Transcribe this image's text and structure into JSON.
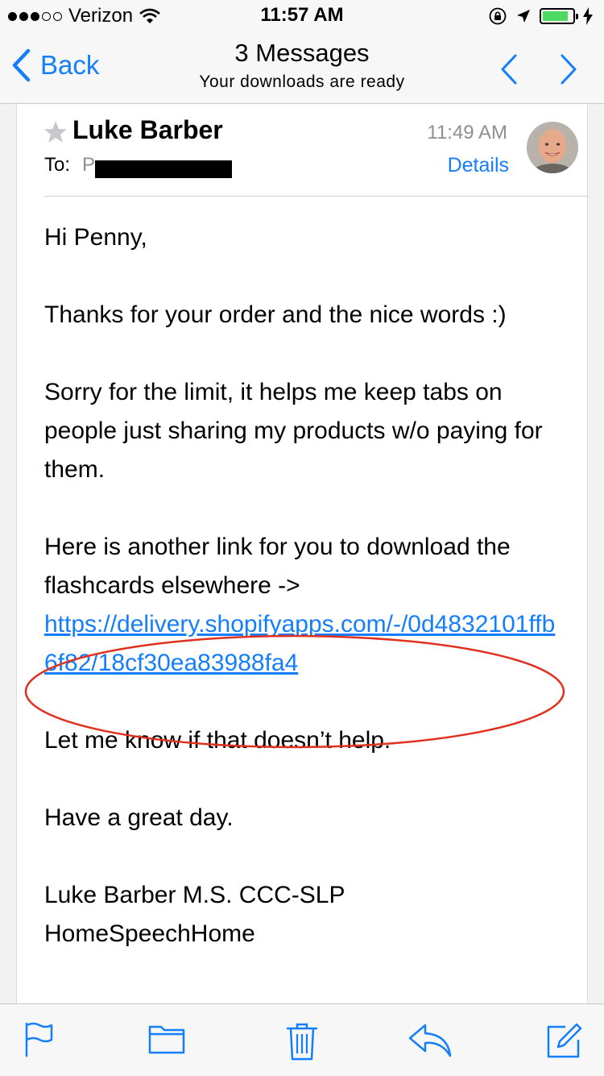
{
  "status_bar": {
    "carrier": "Verizon",
    "time": "11:57 AM",
    "battery_level": 0.85,
    "colors": {
      "battery": "#4cd964"
    }
  },
  "nav": {
    "back_label": "Back",
    "title": "3 Messages",
    "subtitle": "Your downloads are ready",
    "prev_icon": "chevron-up-icon",
    "next_icon": "chevron-down-icon"
  },
  "message": {
    "sender": "Luke Barber",
    "to_label": "To:",
    "to_value": "P",
    "time": "11:49 AM",
    "details_label": "Details",
    "body": {
      "greeting": "Hi Penny,",
      "paragraph1": "Thanks for your order and the nice words :)",
      "paragraph2": "Sorry for the limit, it helps me keep tabs on people just sharing my products w/o paying for them.",
      "paragraph3": "Here is another link for you to download the flashcards elsewhere ->",
      "link": "https://delivery.shopifyapps.com/-/0d4832101ffb6f82/18cf30ea83988fa4",
      "paragraph4": "Let me know if that doesn’t help.",
      "paragraph5": "Have a great day.",
      "signature_name": "Luke Barber M.S. CCC-SLP",
      "signature_company": "HomeSpeechHome"
    }
  },
  "toolbar": {
    "icons": [
      "flag-icon",
      "folder-icon",
      "trash-icon",
      "reply-icon",
      "compose-icon"
    ]
  },
  "colors": {
    "accent": "#147efb",
    "annotation_circle": "#e0301e",
    "secondary_text": "#8e8e93"
  }
}
